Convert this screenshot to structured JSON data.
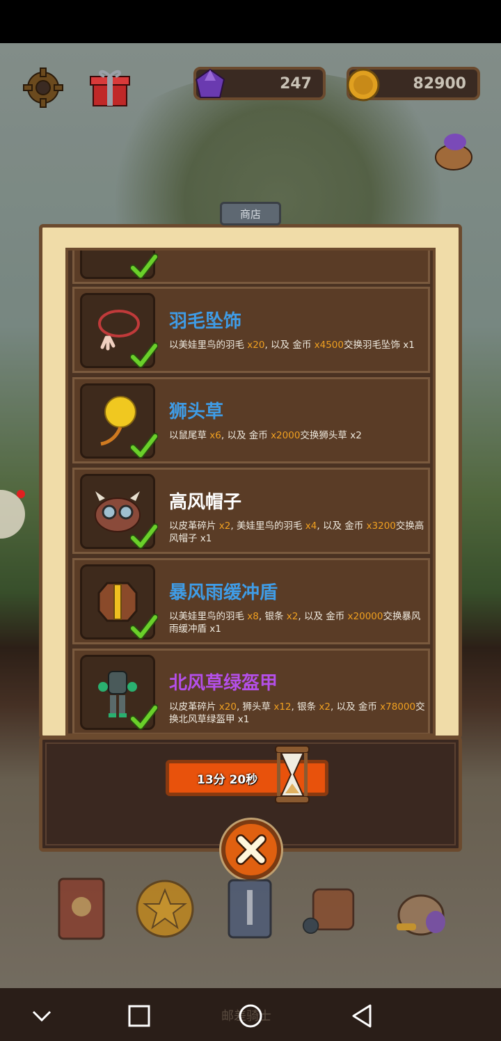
{
  "status_bar": {},
  "header": {
    "gems": "247",
    "coins": "82900"
  },
  "shop": {
    "tab_label": "商店",
    "items": [
      {
        "name": "羽毛坠饰",
        "name_color": "#3f9ce6",
        "desc_parts": [
          "以美娃里鸟的羽毛 ",
          "x20",
          ", 以及 金币 ",
          "x4500",
          "交换羽毛坠饰 x1"
        ],
        "icon": "necklace-icon"
      },
      {
        "name": "狮头草",
        "name_color": "#3f9ce6",
        "desc_parts": [
          "以鼠尾草 ",
          "x6",
          ", 以及 金币 ",
          "x2000",
          "交换狮头草 x2"
        ],
        "icon": "lion-herb-icon"
      },
      {
        "name": "高风帽子",
        "name_color": "#ffffff",
        "desc_parts": [
          "以皮革碎片 ",
          "x2",
          ", 美娃里鸟的羽毛 ",
          "x4",
          ", 以及 金币 ",
          "x3200",
          "交换高风帽子 x1"
        ],
        "icon": "goggles-hat-icon"
      },
      {
        "name": "暴风雨缓冲盾",
        "name_color": "#3f9ce6",
        "desc_parts": [
          "以美娃里鸟的羽毛 ",
          "x8",
          ", 银条 ",
          "x2",
          ", 以及 金币 ",
          "x20000",
          "交换暴风雨缓冲盾 x1"
        ],
        "icon": "shield-icon"
      },
      {
        "name": "北风草绿盔甲",
        "name_color": "#b44fe8",
        "desc_parts": [
          "以皮革碎片 ",
          "x20",
          ", 狮头草 ",
          "x12",
          ", 银条 ",
          "x2",
          ", 以及 金币 ",
          "x78000",
          "交换北风草绿盔甲 x1"
        ],
        "icon": "armor-icon"
      }
    ],
    "timer": "13分 20秒"
  },
  "bottom_menu": [
    "book-icon",
    "star-coin-icon",
    "card-deck-icon",
    "backpack-icon",
    "loot-bag-icon"
  ],
  "watermark": "邮差骑士",
  "colors": {
    "accent": "#e8520c",
    "panel": "#f0dca8",
    "wood": "#6b4a2e",
    "highlight": "#f0a020"
  }
}
